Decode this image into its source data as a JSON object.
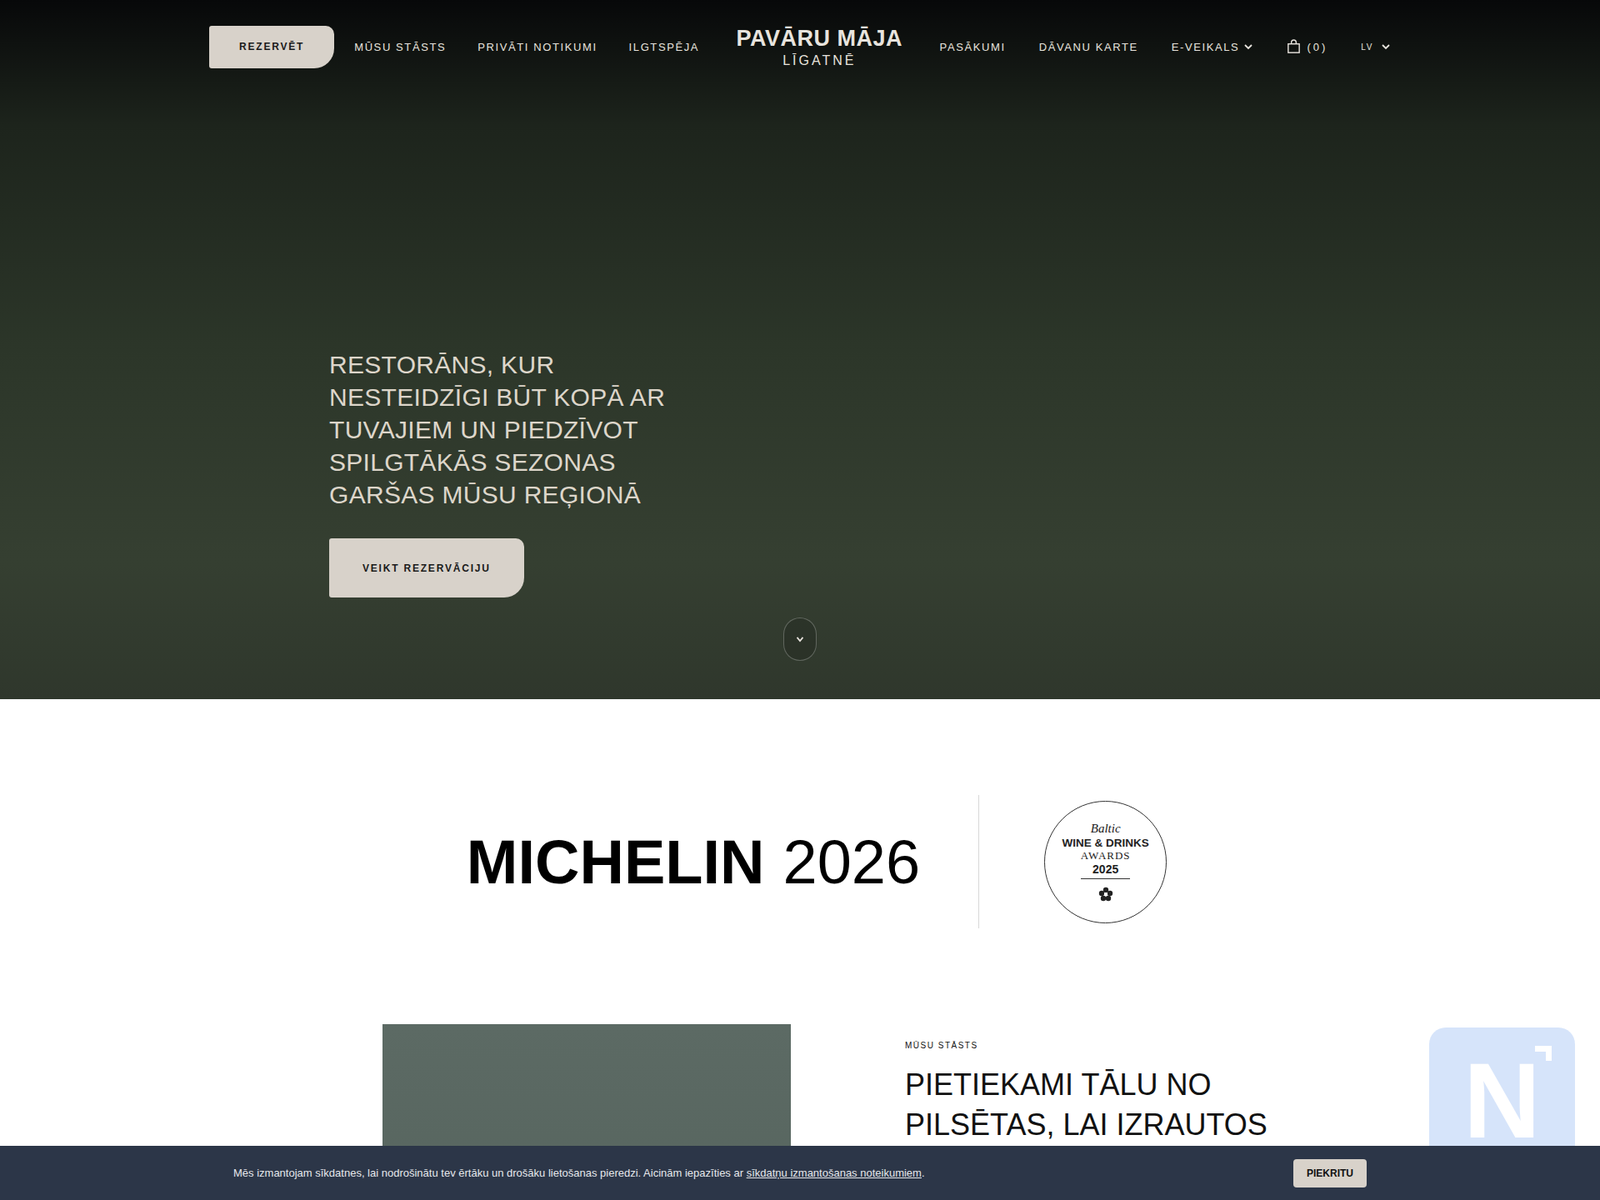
{
  "nav": {
    "reserve_button": "REZERVĒT",
    "left_items": [
      "MŪSU STĀSTS",
      "PRIVĀTI NOTIKUMI",
      "ILGTSPĒJA"
    ],
    "logo": {
      "title": "PAVĀRU MĀJA",
      "subtitle": "LĪGATNĒ"
    },
    "right_items": [
      {
        "label": "PASĀKUMI",
        "dropdown": false
      },
      {
        "label": "DĀVANU KARTE",
        "dropdown": false
      },
      {
        "label": "E-VEIKALS",
        "dropdown": true
      }
    ],
    "cart_count": "(0)",
    "language": "LV"
  },
  "hero": {
    "heading": "RESTORĀNS, KUR NESTEIDZĪGI BŪT KOPĀ AR TUVAJIEM UN PIEDZĪVOT SPILGTĀKĀS SEZONAS GARŠAS MŪSU REĢIONĀ",
    "button": "VEIKT REZERVĀCIJU"
  },
  "awards": {
    "michelin": {
      "name": "MICHELIN",
      "year": "2026"
    },
    "badge": {
      "script": "Baltic",
      "title": "WINE & DRINKS",
      "subtitle": "AWARDS",
      "year": "2025"
    }
  },
  "story": {
    "label": "MŪSU STĀSTS",
    "heading": "PIETIEKAMI TĀLU NO PILSĒTAS, LAI IZRAUTOS"
  },
  "cookie_bar": {
    "text": "Mēs izmantojam sīkdatnes, lai nodrošinātu tev ērtāku un drošāku lietošanas pieredzi. Aicinām iepazīties ar ",
    "link": "sīkdatņu izmantošanas noteikumiem",
    "after": ".",
    "button": "PIEKRITU"
  },
  "widget": {
    "letter": "N"
  }
}
